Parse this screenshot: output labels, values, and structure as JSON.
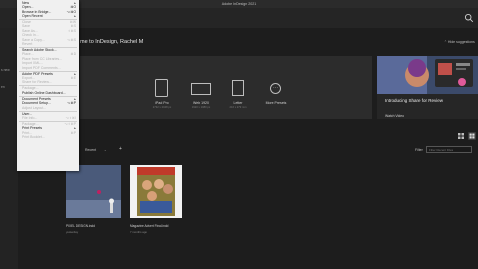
{
  "app": {
    "title": "Adobe InDesign 2021"
  },
  "sidebar": {
    "labels": [
      "s new",
      "en"
    ]
  },
  "home": {
    "welcome": "me to InDesign, Rachel M",
    "hide_suggestions": "Hide suggestions"
  },
  "presets": [
    {
      "label": "iPad Pro",
      "sub": "2732 x 2048 px"
    },
    {
      "label": "Web 1920",
      "sub": "1920 x 1080 px"
    },
    {
      "label": "Letter",
      "sub": "216 x 279 mm"
    },
    {
      "label": "More Presets",
      "sub": ""
    }
  ],
  "promo": {
    "title": "Introducing Share for Review",
    "link": "Watch Video"
  },
  "recent_bar": {
    "sort_label": "Recent",
    "filter_label": "Filter",
    "filter_placeholder": "Filter Recent Files"
  },
  "files": [
    {
      "name": "PIXEL DESIGN.indd",
      "time": "yesterday"
    },
    {
      "name": "Magazine Advert Final.indd",
      "time": "7 months ago"
    }
  ],
  "menu": {
    "items": [
      {
        "label": "New",
        "shortcut": "",
        "arrow": true,
        "disabled": false
      },
      {
        "label": "Open...",
        "shortcut": "⌘O",
        "arrow": false,
        "disabled": false
      },
      {
        "label": "Browse in Bridge...",
        "shortcut": "⌥⌘O",
        "arrow": false,
        "disabled": false
      },
      {
        "label": "Open Recent",
        "shortcut": "",
        "arrow": true,
        "disabled": false
      },
      {
        "sep": true
      },
      {
        "label": "Close",
        "shortcut": "⌘W",
        "arrow": false,
        "disabled": true
      },
      {
        "label": "Save",
        "shortcut": "⌘S",
        "arrow": false,
        "disabled": true
      },
      {
        "label": "Save As...",
        "shortcut": "⇧⌘S",
        "arrow": false,
        "disabled": true
      },
      {
        "label": "Check In...",
        "shortcut": "",
        "arrow": false,
        "disabled": true
      },
      {
        "label": "Save a Copy...",
        "shortcut": "⌥⌘S",
        "arrow": false,
        "disabled": true
      },
      {
        "label": "Revert",
        "shortcut": "",
        "arrow": false,
        "disabled": true
      },
      {
        "sep": true
      },
      {
        "label": "Search Adobe Stock...",
        "shortcut": "",
        "arrow": false,
        "disabled": false
      },
      {
        "label": "Place...",
        "shortcut": "⌘D",
        "arrow": false,
        "disabled": true
      },
      {
        "label": "Place from CC Libraries...",
        "shortcut": "",
        "arrow": false,
        "disabled": true
      },
      {
        "label": "Import XML...",
        "shortcut": "",
        "arrow": false,
        "disabled": true
      },
      {
        "label": "Import PDF Comments...",
        "shortcut": "",
        "arrow": false,
        "disabled": true
      },
      {
        "sep": true
      },
      {
        "label": "Adobe PDF Presets",
        "shortcut": "",
        "arrow": true,
        "disabled": false
      },
      {
        "label": "Export...",
        "shortcut": "⌘E",
        "arrow": false,
        "disabled": true
      },
      {
        "label": "Share for Review...",
        "shortcut": "",
        "arrow": false,
        "disabled": true
      },
      {
        "sep": true
      },
      {
        "label": "Package...",
        "shortcut": "",
        "arrow": false,
        "disabled": true
      },
      {
        "label": "Publish Online Dashboard...",
        "shortcut": "",
        "arrow": false,
        "disabled": false
      },
      {
        "sep": true
      },
      {
        "label": "Document Presets",
        "shortcut": "",
        "arrow": true,
        "disabled": false
      },
      {
        "label": "Document Setup...",
        "shortcut": "⌥⌘P",
        "arrow": false,
        "disabled": false
      },
      {
        "label": "Adjust Layout...",
        "shortcut": "",
        "arrow": false,
        "disabled": true
      },
      {
        "sep": true
      },
      {
        "label": "User...",
        "shortcut": "",
        "arrow": false,
        "disabled": false
      },
      {
        "label": "File Info...",
        "shortcut": "⌥⇧⌘I",
        "arrow": false,
        "disabled": true
      },
      {
        "sep": true
      },
      {
        "label": "Package...",
        "shortcut": "⌥⇧⌘P",
        "arrow": false,
        "disabled": true
      },
      {
        "label": "Print Presets",
        "shortcut": "",
        "arrow": true,
        "disabled": false
      },
      {
        "label": "Print...",
        "shortcut": "⌘P",
        "arrow": false,
        "disabled": true
      },
      {
        "label": "Print Booklet...",
        "shortcut": "",
        "arrow": false,
        "disabled": true
      }
    ]
  },
  "colors": {
    "background": "#1d1d1d",
    "panel": "#2c2c2c",
    "menu_bg": "#f0f0f0"
  },
  "icons": [
    "search-icon",
    "tablet-icon",
    "web-icon",
    "document-icon",
    "more-presets-icon",
    "grid-small-icon",
    "grid-large-icon",
    "chevron-down-icon",
    "plus-icon"
  ]
}
